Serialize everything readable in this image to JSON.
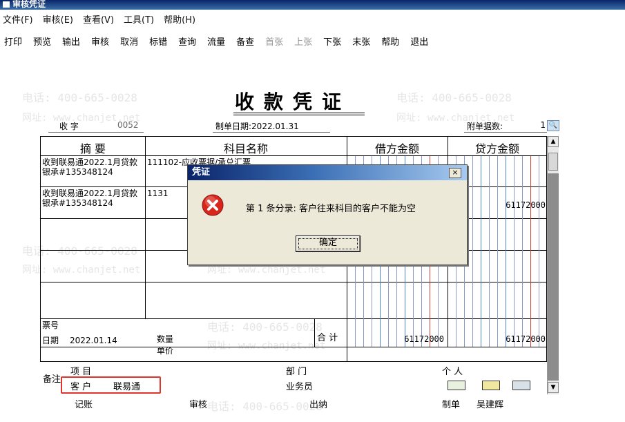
{
  "window": {
    "title": "审核凭证"
  },
  "menu": [
    "文件(F)",
    "审核(E)",
    "查看(V)",
    "工具(T)",
    "帮助(H)"
  ],
  "toolbar": [
    {
      "label": "打印",
      "enabled": true
    },
    {
      "label": "预览",
      "enabled": true
    },
    {
      "label": "输出",
      "enabled": true
    },
    {
      "label": "审核",
      "enabled": true
    },
    {
      "label": "取消",
      "enabled": true
    },
    {
      "label": "标错",
      "enabled": true
    },
    {
      "label": "查询",
      "enabled": true
    },
    {
      "label": "流量",
      "enabled": true
    },
    {
      "label": "备查",
      "enabled": true
    },
    {
      "label": "首张",
      "enabled": false
    },
    {
      "label": "上张",
      "enabled": false
    },
    {
      "label": "下张",
      "enabled": true
    },
    {
      "label": "末张",
      "enabled": true
    },
    {
      "label": "帮助",
      "enabled": true
    },
    {
      "label": "退出",
      "enabled": true
    }
  ],
  "watermark": {
    "phone": "电话: 400-665-0028",
    "site": "网址: www.chanjet.net"
  },
  "voucher": {
    "title": "收款凭证",
    "word": "收    字",
    "number": "0052",
    "date_label": "制单日期:",
    "date": "2022.01.31",
    "attach_label": "附单据数:",
    "attach_count": "1",
    "headers": {
      "summary": "摘 要",
      "subject": "科目名称",
      "debit": "借方金额",
      "credit": "贷方金额"
    },
    "rows": [
      {
        "summary": "收到联易通2022.1月贷款银承#135348124",
        "subject": "111102-应收票据/承兑汇票",
        "debit": "",
        "credit": ""
      },
      {
        "summary": "收到联易通2022.1月贷款银承#135348124",
        "subject": "1131",
        "debit": "",
        "credit": "61172000"
      }
    ],
    "footer": {
      "ticket_label": "票号",
      "date_label": "日期",
      "date_value": "2022.01.14",
      "qty_label": "数量",
      "price_label": "单价",
      "total_label": "合 计",
      "total_debit": "61172000",
      "total_credit": "61172000"
    },
    "notes": {
      "label": "备注",
      "project_label": "项  目",
      "dept_label": "部  门",
      "person_label": "个  人",
      "customer_label": "客  户",
      "customer_value": "联易通",
      "sales_label": "业务员"
    },
    "signatures": {
      "bookkeep": "记账",
      "audit": "审核",
      "cashier": "出纳",
      "maker_label": "制单",
      "maker": "吴建辉"
    }
  },
  "dialog": {
    "title": "凭证",
    "message": "第 1 条分录: 客户往来科目的客户不能为空",
    "ok": "确定",
    "close": "×",
    "icon": "error-icon"
  },
  "colors": {
    "accent_red": "#e0332b",
    "dialog_title": "#0a246a"
  }
}
